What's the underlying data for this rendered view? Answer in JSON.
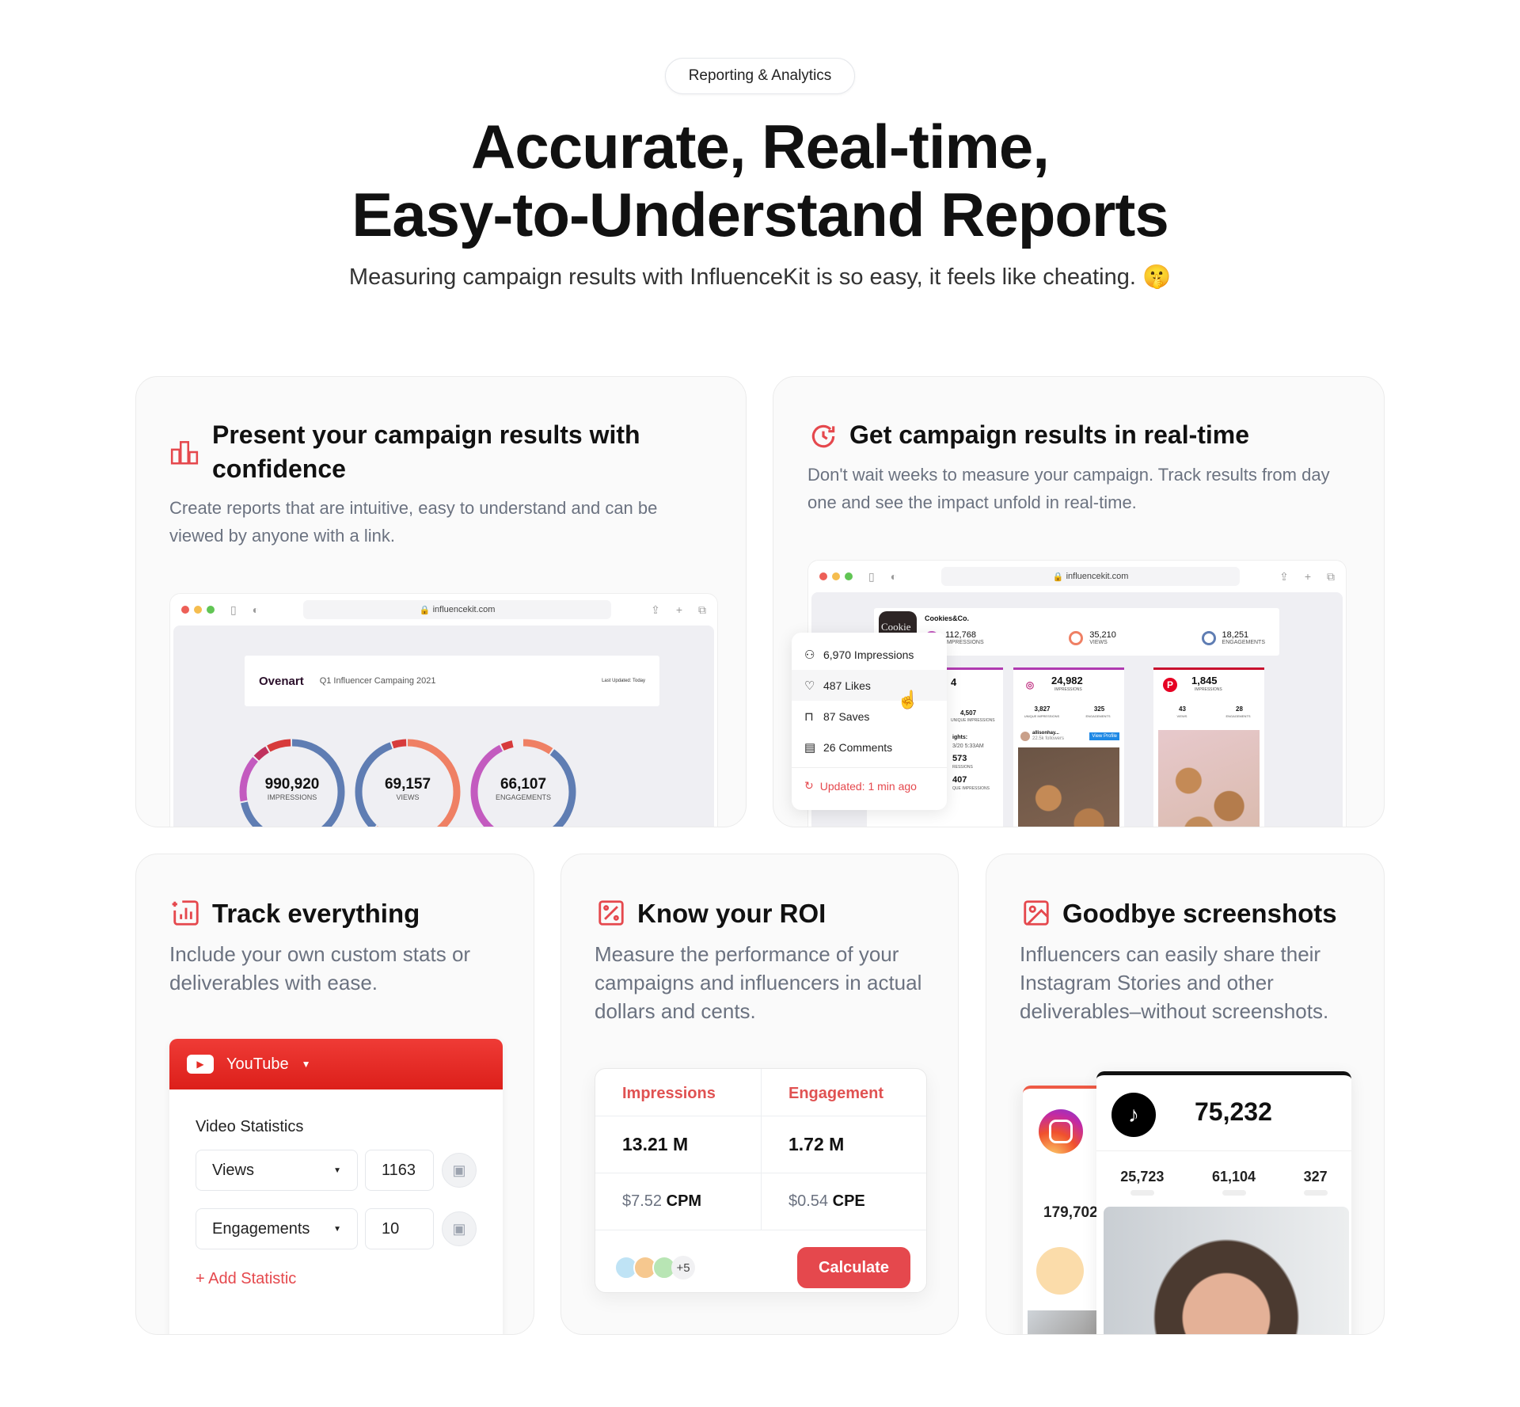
{
  "badge": "Reporting & Analytics",
  "hero": {
    "line1": "Accurate, Real-time,",
    "line2": "Easy-to-Understand Reports",
    "subtitle": "Measuring campaign results with InfluenceKit is so easy, it feels like cheating.",
    "emoji": "🤫"
  },
  "accent": "#e5484d",
  "cards": {
    "present": {
      "title": "Present your campaign results with confidence",
      "desc": "Create reports that are intuitive, easy to understand and can be viewed by anyone with a link.",
      "icon": "bar-chart-icon",
      "browser": {
        "url": "influencekit.com",
        "brand": "Ovenart",
        "report_title": "Q1 Influencer Campaing 2021",
        "updated": "Last Updated: Today",
        "donuts": [
          {
            "value": "990,920",
            "label": "IMPRESSIONS"
          },
          {
            "value": "69,157",
            "label": "VIEWS"
          },
          {
            "value": "66,107",
            "label": "ENGAGEMENTS"
          }
        ]
      }
    },
    "realtime": {
      "title": "Get campaign results in real-time",
      "desc": "Don't wait weeks to measure your campaign. Track results from day one and see the impact unfold in real-time.",
      "icon": "refresh-clock-icon",
      "browser": {
        "url": "influencekit.com",
        "account": "Cookies&Co.",
        "avatar_text": "Cookie",
        "stats": [
          {
            "value": "112,768",
            "label": "IMPRESSIONS"
          },
          {
            "value": "35,210",
            "label": "VIEWS"
          },
          {
            "value": "18,251",
            "label": "ENGAGEMENTS"
          }
        ],
        "partial": {
          "top": "4",
          "a": "4,507",
          "a_label": "UNIQUE IMPRESSIONS",
          "insights": "ights:",
          "date": "3/20 5:33am",
          "b": "573",
          "b_label": "RESSIONS",
          "c": "407",
          "c_label": "QUE IMPRESSIONS"
        },
        "instagram": {
          "value": "24,982",
          "label": "IMPRESSIONS",
          "s1": "3,827",
          "s1_label": "UNIQUE IMPRESSIONS",
          "s2": "325",
          "s2_label": "ENGAGEMENTS",
          "user": "allisonhay...",
          "followers": "22.5k followers",
          "view_profile": "View Profile"
        },
        "pinterest": {
          "value": "1,845",
          "label": "IMPRESSIONS",
          "s1": "43",
          "s1_label": "VIEWS",
          "s2": "28",
          "s2_label": "ENGAGEMENTS"
        }
      },
      "popup": {
        "items": [
          {
            "icon": "user-icon",
            "text": "6,970 Impressions"
          },
          {
            "icon": "heart-icon",
            "text": "487 Likes"
          },
          {
            "icon": "bookmark-icon",
            "text": "87 Saves"
          },
          {
            "icon": "comment-icon",
            "text": "26 Comments"
          }
        ],
        "updated": "Updated: 1 min ago"
      }
    },
    "track": {
      "title": "Track everything",
      "desc": "Include your own custom stats or deliverables with ease.",
      "icon": "add-chart-icon",
      "panel": {
        "platform": "YouTube",
        "section": "Video Statistics",
        "rows": [
          {
            "stat": "Views",
            "value": "1163"
          },
          {
            "stat": "Engagements",
            "value": "10"
          }
        ],
        "add": "Add Statistic"
      }
    },
    "roi": {
      "title": "Know your ROI",
      "desc": "Measure the performance of your campaigns and influencers in actual dollars and cents.",
      "icon": "percent-icon",
      "table": {
        "headers": [
          "Impressions",
          "Engagement"
        ],
        "totals": [
          "13.21 M",
          "1.72 M"
        ],
        "costs": [
          {
            "amount": "$7.52",
            "unit": "CPM"
          },
          {
            "amount": "$0.54",
            "unit": "CPE"
          }
        ],
        "more": "+5",
        "button": "Calculate"
      }
    },
    "screens": {
      "title": "Goodbye screenshots",
      "desc": "Influencers can easily share their Instagram Stories and other deliverables–without screenshots.",
      "icon": "image-icon",
      "instagram_value": "179,702",
      "tiktok": {
        "value": "75,232",
        "stats": [
          "25,723",
          "61,104",
          "327"
        ]
      }
    }
  }
}
